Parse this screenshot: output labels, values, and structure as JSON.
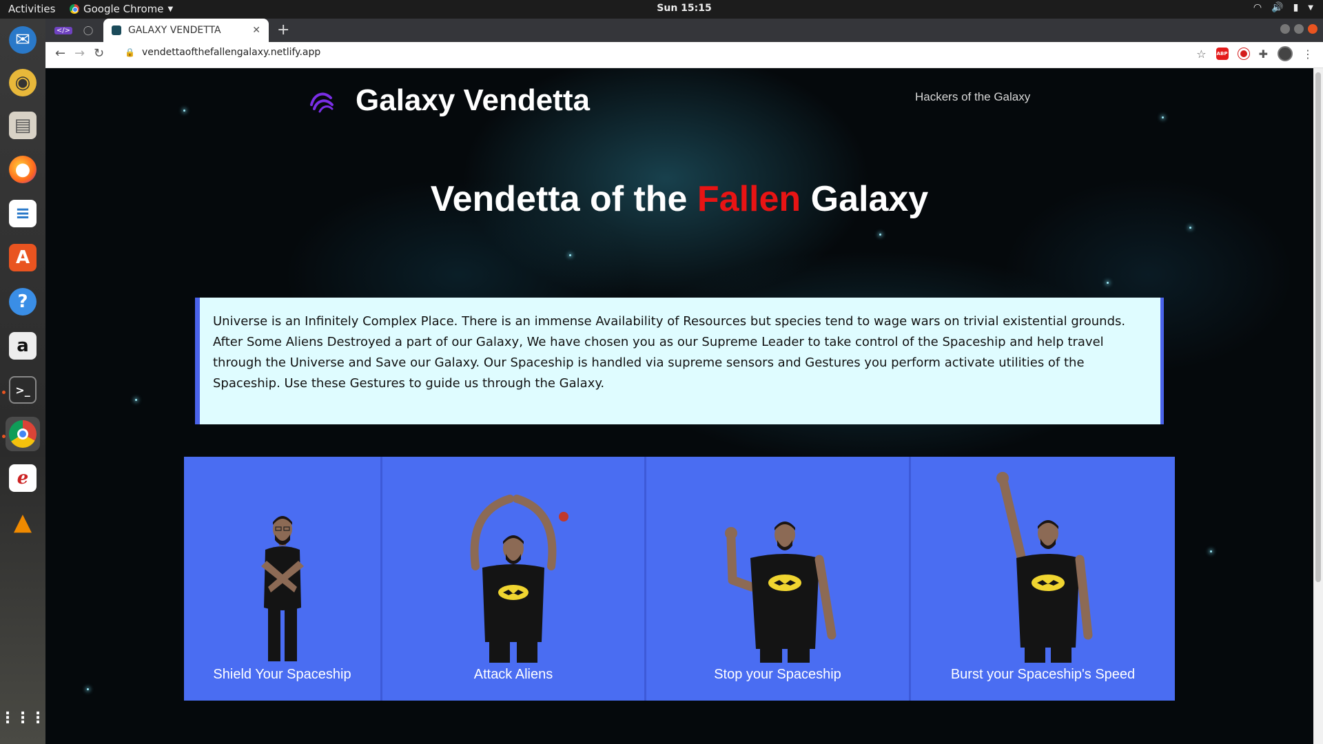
{
  "topbar": {
    "activities": "Activities",
    "app_name": "Google Chrome",
    "clock": "Sun 15:15"
  },
  "browser": {
    "active_tab_title": "GALAXY VENDETTA",
    "url": "vendettaofthefallengalaxy.netlify.app",
    "abp_label": "ABP"
  },
  "site": {
    "brand": "Galaxy Vendetta",
    "nav_link": "Hackers of the Galaxy",
    "hero": {
      "part1": "Vendetta of the ",
      "highlight": "Fallen",
      "part2": " Galaxy",
      "highlight_color": "#e81414"
    },
    "intro": "Universe is an Infinitely Complex Place. There is an immense Availability of Resources but species tend to wage wars on trivial existential grounds. After Some Aliens Destroyed a part of our Galaxy, We have chosen you as our Supreme Leader to take control of the Spaceship and help travel through the Universe and Save our Galaxy. Our Spaceship is handled via supreme sensors and Gestures you perform activate utilities of the Spaceship. Use these Gestures to guide us through the Galaxy.",
    "gestures": [
      {
        "label": "Shield Your Spaceship"
      },
      {
        "label": "Attack Aliens"
      },
      {
        "label": "Stop your Spaceship"
      },
      {
        "label": "Burst your Spaceship's Speed"
      }
    ],
    "accent_color": "#4a6df2"
  }
}
